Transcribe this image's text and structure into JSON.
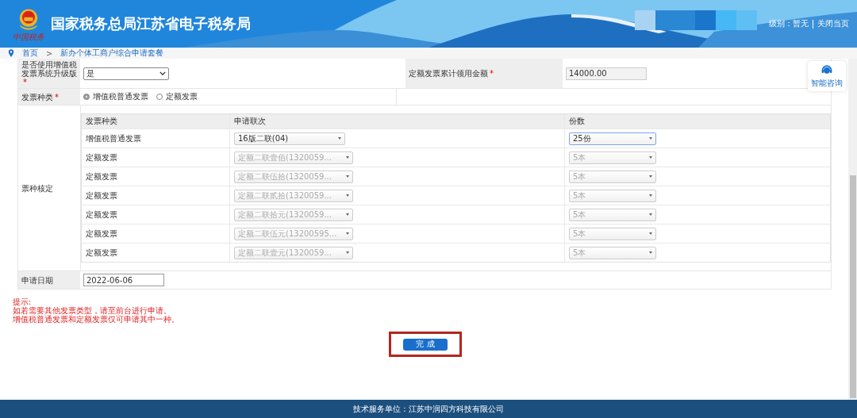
{
  "header": {
    "title": "国家税务总局江苏省电子税务局",
    "logo_caption": "中国税务",
    "level_text": "级别：暂无",
    "close_link": "关闭当页"
  },
  "breadcrumb": [
    "首页",
    "新办个体工商户综合申请套餐"
  ],
  "breadcrumb_separator": ">",
  "required_mark": "*",
  "help": {
    "label": "智能咨询"
  },
  "form": {
    "upgrade": {
      "label": "是否使用增值税发票系统升级版",
      "required": true,
      "value": "是"
    },
    "quota": {
      "label": "定额发票累计领用金额",
      "required": true,
      "value": "14000.00"
    },
    "invoice_type": {
      "label": "发票种类",
      "required": true,
      "options": [
        {
          "label": "增值税普通发票",
          "selected": true
        },
        {
          "label": "定额发票",
          "selected": false
        }
      ]
    },
    "verify": {
      "label": "票种核定",
      "columns": [
        "发票种类",
        "申请联次",
        "份数"
      ],
      "rows": [
        {
          "type": "增值税普通发票",
          "copy": "16版二联(04)",
          "count": "25份",
          "disabled": false
        },
        {
          "type": "定额发票",
          "copy": "定额二联壹佰(1320059...",
          "count": "5本",
          "disabled": true
        },
        {
          "type": "定额发票",
          "copy": "定额二联伍拾(1320059...",
          "count": "5本",
          "disabled": true
        },
        {
          "type": "定额发票",
          "copy": "定额二联贰拾(1320059...",
          "count": "5本",
          "disabled": true
        },
        {
          "type": "定额发票",
          "copy": "定额二联拾元(1320059...",
          "count": "5本",
          "disabled": true
        },
        {
          "type": "定额发票",
          "copy": "定额二联伍元(13200595...",
          "count": "5本",
          "disabled": true
        },
        {
          "type": "定额发票",
          "copy": "定额二联壹元(1320059...",
          "count": "5本",
          "disabled": true
        }
      ]
    },
    "date": {
      "label": "申请日期",
      "value": "2022-06-06"
    }
  },
  "tips": [
    "提示:",
    "如若需要其他发票类型，请至前台进行申请。",
    "增值税普通发票和定额发票仅可申请其中一种。"
  ],
  "submit": "完 成",
  "footer": "技术服务单位：江苏中润四方科技有限公司"
}
